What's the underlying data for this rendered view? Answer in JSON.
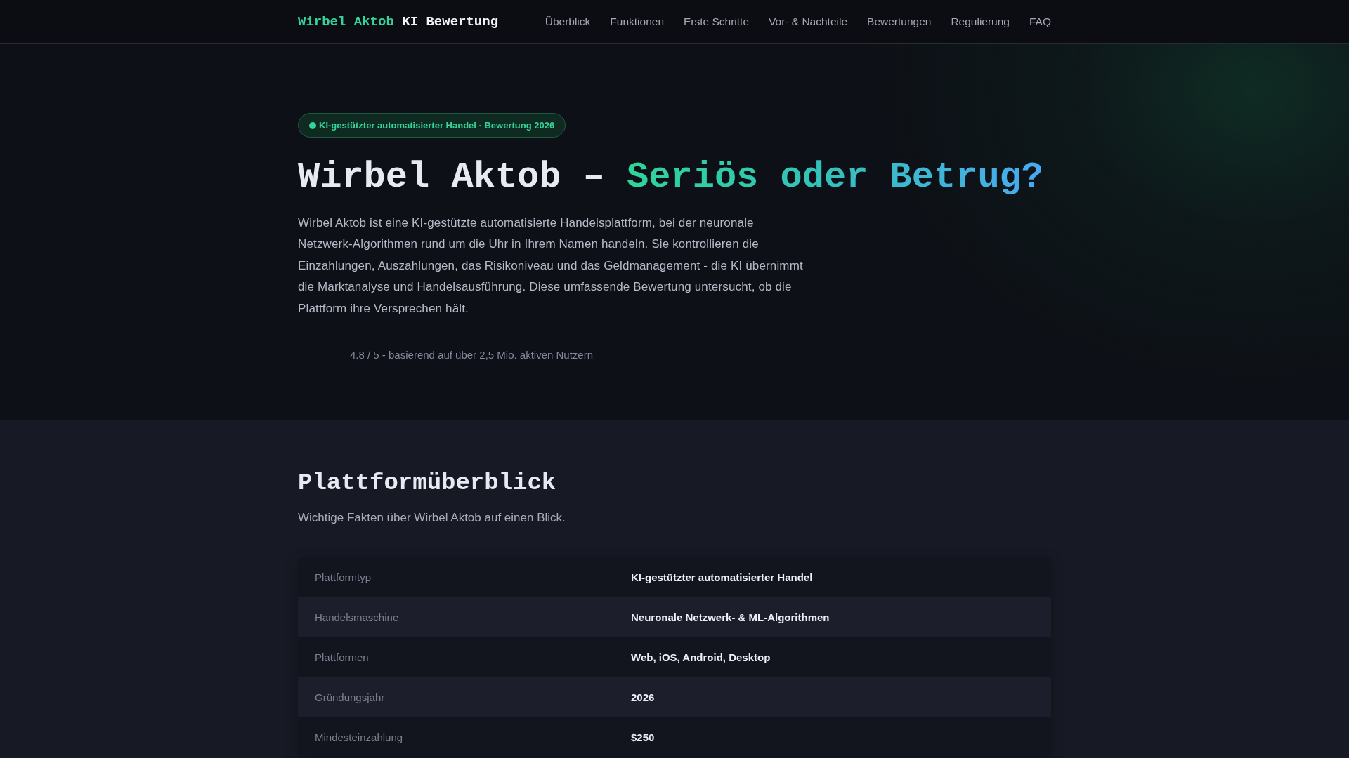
{
  "header": {
    "logo": {
      "brand": "Wirbel Aktob",
      "suffix": "KI Bewertung"
    },
    "nav": [
      "Überblick",
      "Funktionen",
      "Erste Schritte",
      "Vor- & Nachteile",
      "Bewertungen",
      "Regulierung",
      "FAQ"
    ]
  },
  "hero": {
    "badge": "KI-gestützter automatisierter Handel · Bewertung 2026",
    "title": {
      "lead": "Wirbel Aktob –",
      "highlight": "Seriös oder Betrug?"
    },
    "intro": "Wirbel Aktob ist eine KI-gestützte automatisierte Handelsplattform, bei der neuronale Netzwerk-Algorithmen rund um die Uhr in Ihrem Namen handeln. Sie kontrollieren die Einzahlungen, Auszahlungen, das Risikoniveau und das Geldmanagement - die KI übernimmt die Marktanalyse und Handelsausführung. Diese umfassende Bewertung untersucht, ob die Plattform ihre Versprechen hält.",
    "rating": "4.8 / 5 - basierend auf über 2,5 Mio. aktiven Nutzern"
  },
  "overview": {
    "heading": "Plattformüberblick",
    "subtitle": "Wichtige Fakten über Wirbel Aktob auf einen Blick.",
    "table": {
      "rows": [
        {
          "label": "Plattformtyp",
          "value": "KI-gestützter automatisierter Handel"
        },
        {
          "label": "Handelsmaschine",
          "value": "Neuronale Netzwerk- & ML-Algorithmen"
        },
        {
          "label": "Plattformen",
          "value": "Web, iOS, Android, Desktop"
        },
        {
          "label": "Gründungsjahr",
          "value": "2026"
        },
        {
          "label": "Mindesteinzahlung",
          "value": "$250"
        }
      ]
    }
  }
}
